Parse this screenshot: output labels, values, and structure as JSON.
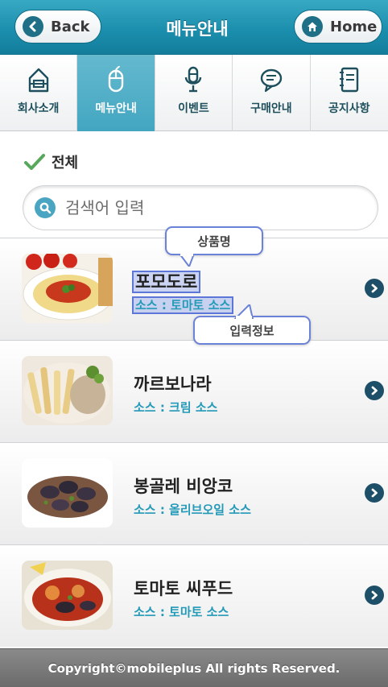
{
  "header": {
    "title": "메뉴안내",
    "back_label": "Back",
    "home_label": "Home"
  },
  "tabs": [
    {
      "label": "회사소개",
      "icon": "house-icon",
      "active": false
    },
    {
      "label": "메뉴안내",
      "icon": "mouse-icon",
      "active": true
    },
    {
      "label": "이벤트",
      "icon": "microphone-icon",
      "active": false
    },
    {
      "label": "구매안내",
      "icon": "chat-bubble-icon",
      "active": false
    },
    {
      "label": "공지사항",
      "icon": "notebook-icon",
      "active": false
    }
  ],
  "category": {
    "label": "전체"
  },
  "search": {
    "placeholder": "검색어 입력",
    "value": ""
  },
  "items": [
    {
      "title": "포모도로",
      "subtitle": "소스 : 토마토 소스"
    },
    {
      "title": "까르보나라",
      "subtitle": "소스 : 크림 소스"
    },
    {
      "title": "봉골레 비앙코",
      "subtitle": "소스 : 올리브오일 소스"
    },
    {
      "title": "토마토 씨푸드",
      "subtitle": "소스 : 토마토 소스"
    }
  ],
  "annotations": {
    "product_name": "상품명",
    "input_info": "입력정보"
  },
  "footer": {
    "text": "Copyright©mobileplus All rights Reserved."
  },
  "colors": {
    "accent": "#1c8fae",
    "subtitle": "#239ab8",
    "highlight": "#5d77d8"
  }
}
